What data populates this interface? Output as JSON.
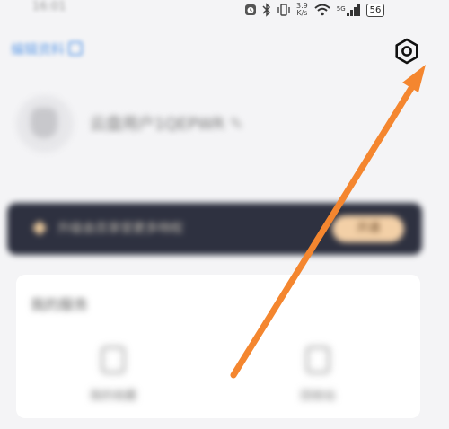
{
  "status_bar": {
    "time": "16:01",
    "speed_top": "3.9",
    "speed_bottom": "K/s",
    "network": "5G",
    "battery": "56"
  },
  "top_link": {
    "label": "编辑资料"
  },
  "profile": {
    "username": "云盘用户1QEPWR"
  },
  "vip_banner": {
    "text": "升级会员享受更多特权",
    "button": "开通"
  },
  "services": {
    "title": "我的服务",
    "items": [
      {
        "label": "我的收藏",
        "icon": "bookmark-icon"
      },
      {
        "label": "回收站",
        "icon": "trash-icon"
      }
    ]
  },
  "colors": {
    "accent": "#6aa2e8",
    "arrow": "#f4862f",
    "vip_bg": "#2e3140",
    "vip_button": "#f3d0a7"
  }
}
